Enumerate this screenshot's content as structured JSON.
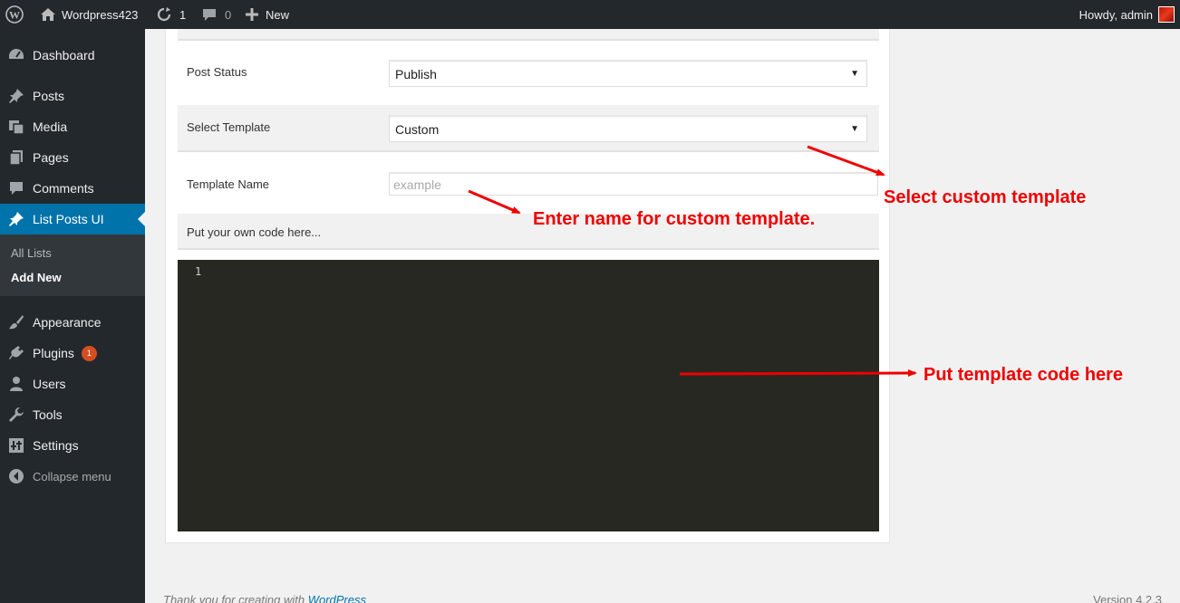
{
  "adminbar": {
    "site_name": "Wordpress423",
    "updates_count": "1",
    "comments_count": "0",
    "new_label": "New",
    "howdy": "Howdy, admin"
  },
  "sidebar": {
    "items": [
      {
        "label": "Dashboard",
        "icon": "dashboard-icon"
      },
      {
        "label": "Posts",
        "icon": "pushpin-icon"
      },
      {
        "label": "Media",
        "icon": "media-icon"
      },
      {
        "label": "Pages",
        "icon": "pages-icon"
      },
      {
        "label": "Comments",
        "icon": "comment-icon"
      },
      {
        "label": "List Posts UI",
        "icon": "pushpin-icon"
      },
      {
        "label": "Appearance",
        "icon": "paintbrush-icon"
      },
      {
        "label": "Plugins",
        "icon": "plug-icon"
      },
      {
        "label": "Users",
        "icon": "user-icon"
      },
      {
        "label": "Tools",
        "icon": "wrench-icon"
      },
      {
        "label": "Settings",
        "icon": "settings-icon"
      }
    ],
    "submenu": [
      "All Lists",
      "Add New"
    ],
    "plugins_badge": "1",
    "collapse_label": "Collapse menu"
  },
  "form": {
    "post_status_label": "Post Status",
    "post_status_value": "Publish",
    "select_template_label": "Select Template",
    "select_template_value": "Custom",
    "template_name_label": "Template Name",
    "template_name_placeholder": "example",
    "own_code_label": "Put your own code here...",
    "editor_line_number": "1"
  },
  "annotations": {
    "select_custom": "Select custom template",
    "enter_name": "Enter name for custom template.",
    "put_code": "Put template code here"
  },
  "footer": {
    "thanks_prefix": "Thank you for creating with ",
    "thanks_link": "WordPress",
    "version": "Version 4.2.3"
  },
  "colors": {
    "admin_dark": "#23282d",
    "accent_blue": "#0073aa",
    "annotation_red": "#ee0000",
    "editor_bg": "#272822"
  }
}
